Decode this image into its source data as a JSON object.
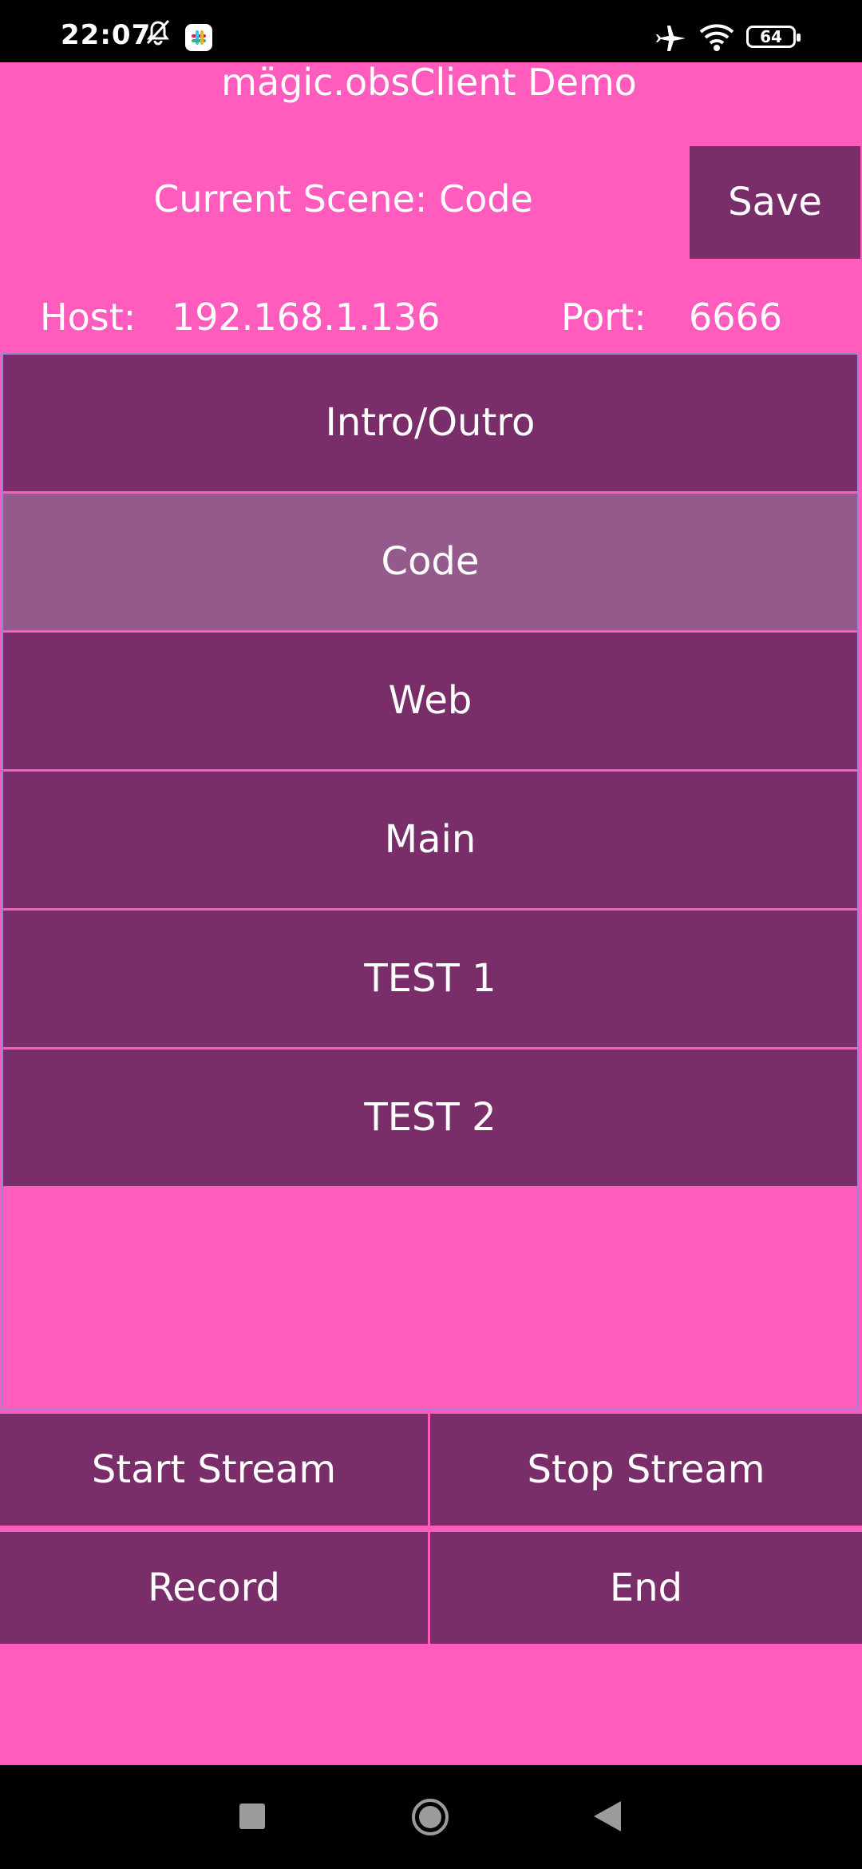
{
  "status_bar": {
    "time": "22:07",
    "battery": "64",
    "icons": [
      "bell-off-icon",
      "slack-icon",
      "airplane-icon",
      "wifi-icon",
      "battery-icon"
    ]
  },
  "app": {
    "title": "mägic.obsClient Demo",
    "current_scene": "Current Scene: Code",
    "save_label": "Save",
    "host_label": "Host:",
    "host_value": "192.168.1.136",
    "port_label": "Port:",
    "port_value": "6666"
  },
  "scenes": [
    {
      "label": "Intro/Outro",
      "selected": false
    },
    {
      "label": "Code",
      "selected": true
    },
    {
      "label": "Web",
      "selected": false
    },
    {
      "label": "Main",
      "selected": false
    },
    {
      "label": "TEST 1",
      "selected": false
    },
    {
      "label": "TEST 2",
      "selected": false
    }
  ],
  "controls": {
    "start_stream": "Start Stream",
    "stop_stream": "Stop Stream",
    "record": "Record",
    "end": "End"
  },
  "nav_bar": {
    "icons": [
      "recents-square-icon",
      "home-circle-icon",
      "back-triangle-icon"
    ]
  },
  "colors": {
    "background": "#ff5cbd",
    "button": "#7a2e69",
    "selected": "#955a8c",
    "list_border": "#9a84d8"
  }
}
